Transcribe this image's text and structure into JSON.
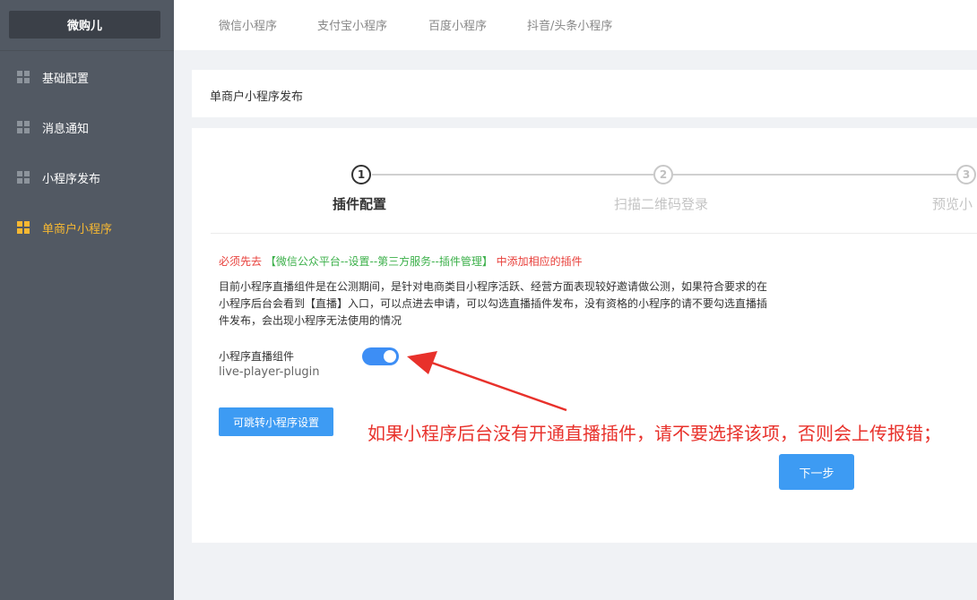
{
  "sidebar": {
    "brand": "微购儿",
    "items": [
      {
        "label": "基础配置",
        "active": false
      },
      {
        "label": "消息通知",
        "active": false
      },
      {
        "label": "小程序发布",
        "active": false
      },
      {
        "label": "单商户小程序",
        "active": true
      }
    ]
  },
  "tabs": [
    "微信小程序",
    "支付宝小程序",
    "百度小程序",
    "抖音/头条小程序"
  ],
  "page_title": "单商户小程序发布",
  "steps": [
    {
      "num": "1",
      "label": "插件配置",
      "active": true
    },
    {
      "num": "2",
      "label": "扫描二维码登录",
      "active": false
    },
    {
      "num": "3",
      "label": "预览小",
      "active": false
    }
  ],
  "notice": {
    "prefix": "必须先去",
    "path": "【微信公众平台--设置--第三方服务--插件管理】",
    "suffix": "中添加相应的插件"
  },
  "description": "目前小程序直播组件是在公测期间，是针对电商类目小程序活跃、经营方面表现较好邀请做公测，如果符合要求的在小程序后台会看到【直播】入口，可以点进去申请，可以勾选直播插件发布，没有资格的小程序的请不要勾选直播插件发布，会出现小程序无法使用的情况",
  "plugin": {
    "label": "小程序直播组件",
    "code": "live-player-plugin",
    "enabled": true
  },
  "buttons": {
    "settings": "可跳转小程序设置",
    "next": "下一步"
  },
  "annotation": "如果小程序后台没有开通直播插件，请不要选择该项，否则会上传报错；",
  "colors": {
    "sidebar_bg": "#525963",
    "accent_yellow": "#f7b832",
    "primary_blue": "#3d9bf3",
    "warn_red": "#e8403b",
    "link_green": "#3cb04a"
  }
}
